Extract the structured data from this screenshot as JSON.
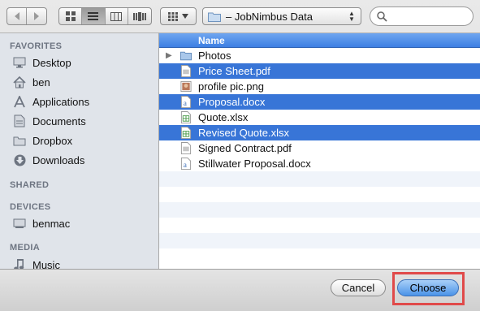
{
  "toolbar": {
    "location": "– JobNimbus Data",
    "search_placeholder": ""
  },
  "sidebar": {
    "favorites_header": "FAVORITES",
    "favorites": [
      {
        "label": "Desktop",
        "icon": "desktop-icon"
      },
      {
        "label": "ben",
        "icon": "home-icon"
      },
      {
        "label": "Applications",
        "icon": "applications-icon"
      },
      {
        "label": "Documents",
        "icon": "documents-icon"
      },
      {
        "label": "Dropbox",
        "icon": "dropbox-icon"
      },
      {
        "label": "Downloads",
        "icon": "downloads-icon"
      }
    ],
    "shared_header": "SHARED",
    "devices_header": "DEVICES",
    "devices": [
      {
        "label": "benmac",
        "icon": "computer-icon"
      }
    ],
    "media_header": "MEDIA",
    "media": [
      {
        "label": "Music",
        "icon": "music-icon"
      }
    ]
  },
  "filelist": {
    "column_name": "Name",
    "files": [
      {
        "name": "Photos",
        "type": "folder",
        "selected": false
      },
      {
        "name": "Price Sheet.pdf",
        "type": "pdf",
        "selected": true
      },
      {
        "name": "profile pic.png",
        "type": "image",
        "selected": false
      },
      {
        "name": "Proposal.docx",
        "type": "docx",
        "selected": true
      },
      {
        "name": "Quote.xlsx",
        "type": "xlsx",
        "selected": false
      },
      {
        "name": "Revised Quote.xlsx",
        "type": "xlsx",
        "selected": true
      },
      {
        "name": "Signed Contract.pdf",
        "type": "pdf",
        "selected": false
      },
      {
        "name": "Stillwater Proposal.docx",
        "type": "docx",
        "selected": false
      }
    ]
  },
  "buttons": {
    "cancel": "Cancel",
    "choose": "Choose"
  },
  "colors": {
    "selection": "#3875d7",
    "highlight_box": "#e04a4a"
  }
}
